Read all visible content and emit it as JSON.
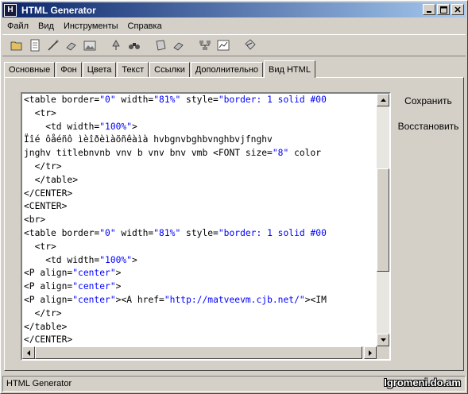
{
  "window": {
    "title": "HTML Generator",
    "app_icon": "H"
  },
  "menu": [
    "Файл",
    "Вид",
    "Инструменты",
    "Справка"
  ],
  "toolbar_icons": [
    "folder-open-icon",
    "notepad-icon",
    "wand-icon",
    "eraser-icon",
    "image-icon",
    "tree-icon",
    "binoculars-icon",
    "clipboard-icon",
    "eraser2-icon",
    "network-icon",
    "chart-icon",
    "edit-icon"
  ],
  "tabs": [
    "Основные",
    "Фон",
    "Цвета",
    "Текст",
    "Ссылки",
    "Дополнительно",
    "Вид HTML"
  ],
  "active_tab": 6,
  "editor_lines": [
    "<table border=\"0\" width=\"81%\" style=\"border: 1 solid #00",
    "  <tr>",
    "    <td width=\"100%\">",
    "Ïîé ôåéñô ìèîðèìàõñêàìà hvbgnvbghbvnghbvjfnghv",
    "jnghv titlebnvnb vnv b vnv bnv vmb <FONT size=\"8\" color",
    "  </tr>",
    "  </table>",
    "</CENTER>",
    "<CENTER>",
    "<br>",
    "<table border=\"0\" width=\"81%\" style=\"border: 1 solid #00",
    "  <tr>",
    "    <td width=\"100%\">",
    "<P align=\"center\">",
    "<P align=\"center\">",
    "<P align=\"center\"><A href=\"http://matveevm.cjb.net/\"><IM",
    "  </tr>",
    "</table>",
    "</CENTER>"
  ],
  "buttons": {
    "save": "Сохранить",
    "restore": "Восстановить"
  },
  "status": "HTML Generator",
  "watermark": "Igromeni.do.am"
}
